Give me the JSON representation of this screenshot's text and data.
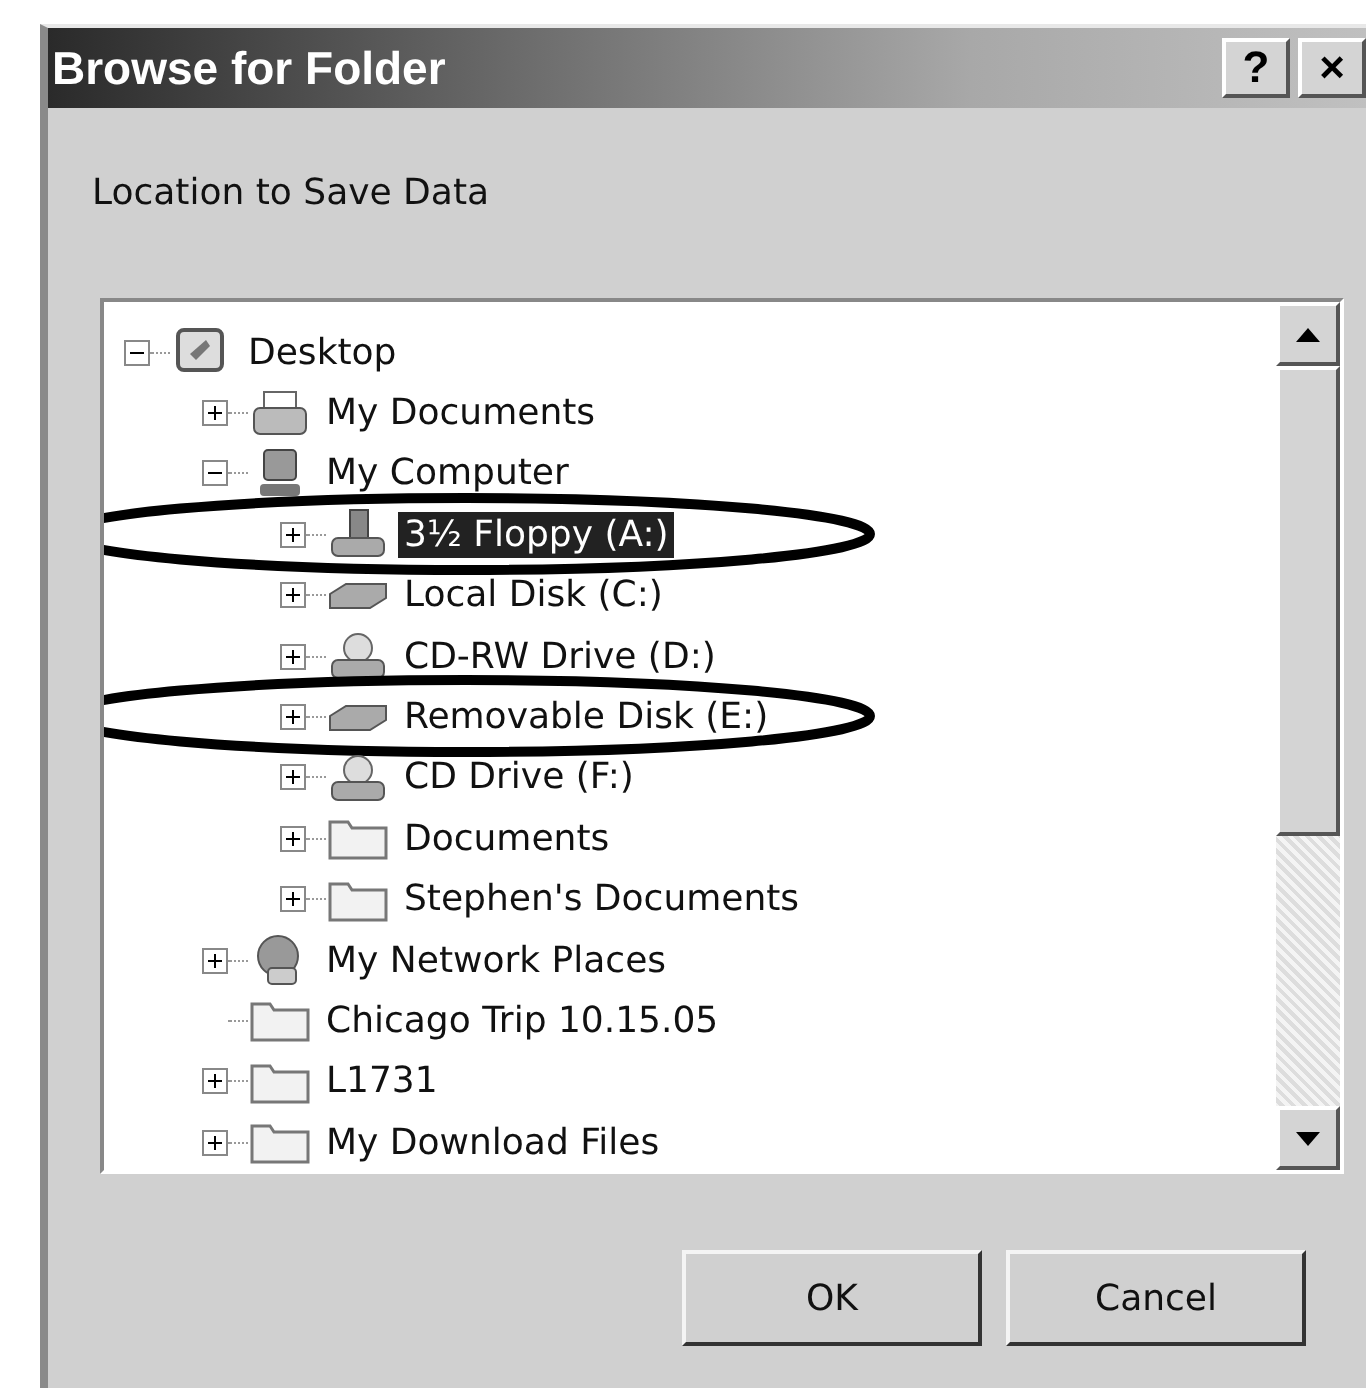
{
  "window": {
    "title": "Browse for Folder",
    "buttons": [
      "?",
      "×"
    ]
  },
  "prompt": "Location to Save Data",
  "tree": [
    {
      "label": "Desktop",
      "kind": "desktop",
      "expanded": true,
      "selected": false,
      "circled": false,
      "children": [
        {
          "label": "My Documents",
          "kind": "documents",
          "expanded": false,
          "selected": false,
          "circled": false
        },
        {
          "label": "My Computer",
          "kind": "computer",
          "expanded": true,
          "selected": false,
          "circled": false,
          "children": [
            {
              "label": "3½ Floppy (A:)",
              "kind": "floppy",
              "expanded": false,
              "selected": true,
              "circled": true
            },
            {
              "label": "Local Disk (C:)",
              "kind": "disk",
              "expanded": false,
              "selected": false,
              "circled": false
            },
            {
              "label": "CD-RW Drive (D:)",
              "kind": "cd",
              "expanded": false,
              "selected": false,
              "circled": false
            },
            {
              "label": "Removable Disk (E:)",
              "kind": "disk",
              "expanded": false,
              "selected": false,
              "circled": true
            },
            {
              "label": "CD Drive (F:)",
              "kind": "cd",
              "expanded": false,
              "selected": false,
              "circled": false
            },
            {
              "label": "Documents",
              "kind": "folder",
              "expanded": false,
              "selected": false,
              "circled": false
            },
            {
              "label": "Stephen's Documents",
              "kind": "folder",
              "expanded": false,
              "selected": false,
              "circled": false
            }
          ]
        },
        {
          "label": "My Network Places",
          "kind": "network",
          "expanded": false,
          "selected": false,
          "circled": false
        },
        {
          "label": "Chicago Trip 10.15.05",
          "kind": "folder",
          "selected": false,
          "circled": false
        },
        {
          "label": "L1731",
          "kind": "folder",
          "expanded": false,
          "selected": false,
          "circled": false
        },
        {
          "label": "My Download Files",
          "kind": "folder",
          "expanded": false,
          "selected": false,
          "circled": false
        }
      ]
    }
  ],
  "buttons": [
    "OK",
    "Cancel"
  ]
}
